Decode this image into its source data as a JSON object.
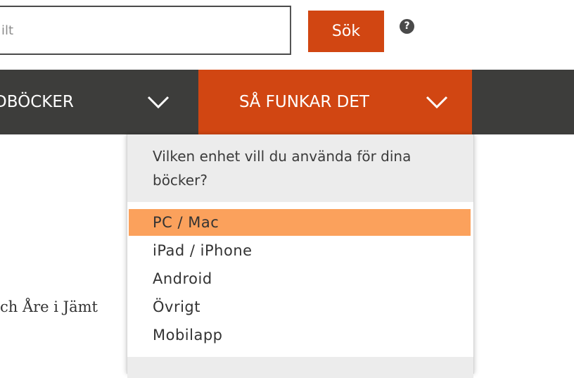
{
  "search": {
    "placeholder": "ilt",
    "button_label": "Sök",
    "help_symbol": "?"
  },
  "nav": {
    "items": [
      {
        "label": "DBÖCKER",
        "icon": "chevron-down-icon"
      },
      {
        "label": "SÅ FUNKAR DET",
        "icon": "chevron-down-icon"
      }
    ]
  },
  "dropdown": {
    "question": "Vilken enhet vill du använda för dina böcker?",
    "options": [
      "PC / Mac",
      "iPad / iPhone",
      "Android",
      "Övrigt",
      "Mobilapp"
    ],
    "selected": "PC / Mac"
  },
  "article": {
    "partial_text": "ch Åre i Jämt"
  },
  "colors": {
    "accent": "#d14612",
    "nav_background": "#3d3d3b",
    "selected_option": "#fba15c",
    "dropdown_header": "#ececec"
  }
}
